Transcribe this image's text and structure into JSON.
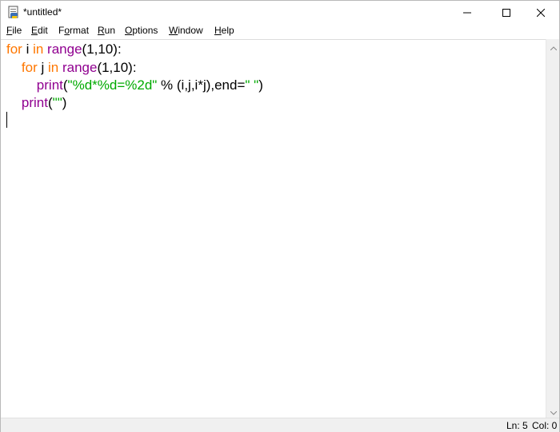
{
  "window": {
    "title": "*untitled*"
  },
  "menu": [
    {
      "mnemonic": "F",
      "rest": "ile"
    },
    {
      "mnemonic": "E",
      "rest": "dit"
    },
    {
      "mnemonic": "",
      "pre": "F",
      "u": "o",
      "rest": "rmat"
    },
    {
      "mnemonic": "R",
      "rest": "un"
    },
    {
      "mnemonic": "O",
      "rest": "ptions"
    },
    {
      "mnemonic": "W",
      "rest": "indow"
    },
    {
      "mnemonic": "H",
      "rest": "elp"
    }
  ],
  "menu_labels": {
    "file": {
      "m": "F",
      "r": "ile"
    },
    "edit": {
      "m": "E",
      "r": "dit"
    },
    "format": {
      "p": "F",
      "m": "o",
      "r": "rmat"
    },
    "run": {
      "m": "R",
      "r": "un"
    },
    "options": {
      "m": "O",
      "r": "ptions"
    },
    "window": {
      "m": "W",
      "r": "indow"
    },
    "help": {
      "m": "H",
      "r": "elp"
    }
  },
  "code": {
    "line1": {
      "kw1": "for",
      "t1": " i ",
      "kw2": "in",
      "t2": " ",
      "bi": "range",
      "t3": "(1,10):"
    },
    "line2": {
      "indent": "    ",
      "kw1": "for",
      "t1": " j ",
      "kw2": "in",
      "t2": " ",
      "bi": "range",
      "t3": "(1,10):"
    },
    "line3": {
      "indent": "        ",
      "bi": "print",
      "t1": "(",
      "str": "\"%d*%d=%2d\"",
      "t2": " % (i,j,i*j),end=",
      "str2": "\" \"",
      "t3": ")"
    },
    "line4": {
      "indent": "    ",
      "bi": "print",
      "t1": "(",
      "str": "\"\"",
      "t2": ")"
    }
  },
  "status": {
    "ln": "Ln: 5",
    "col": "Col: 0"
  },
  "colors": {
    "keyword": "#ff7700",
    "builtin": "#900090",
    "string": "#00aa00"
  },
  "icons": {
    "app": "idle-python-icon",
    "minimize": "minimize-icon",
    "maximize": "maximize-icon",
    "close": "close-icon"
  }
}
